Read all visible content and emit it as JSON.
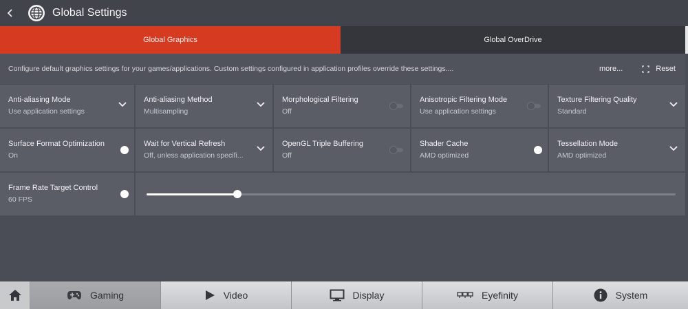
{
  "header": {
    "title": "Global Settings"
  },
  "tabs": [
    {
      "label": "Global Graphics",
      "active": true
    },
    {
      "label": "Global OverDrive",
      "active": false
    }
  ],
  "info": {
    "text": "Configure default graphics settings for your games/applications. Custom settings configured in application profiles override these settings....",
    "more_label": "more...",
    "reset_label": "Reset"
  },
  "settings": {
    "row1": [
      {
        "label": "Anti-aliasing Mode",
        "value": "Use application settings",
        "control": "dropdown"
      },
      {
        "label": "Anti-aliasing Method",
        "value": "Multisampling",
        "control": "dropdown"
      },
      {
        "label": "Morphological Filtering",
        "value": "Off",
        "control": "toggle",
        "on": false
      },
      {
        "label": "Anisotropic Filtering Mode",
        "value": "Use application settings",
        "control": "toggle",
        "on": false
      },
      {
        "label": "Texture Filtering Quality",
        "value": "Standard",
        "control": "dropdown"
      }
    ],
    "row2": [
      {
        "label": "Surface Format Optimization",
        "value": "On",
        "control": "toggle",
        "on": true
      },
      {
        "label": "Wait for Vertical Refresh",
        "value": "Off, unless application specifi...",
        "control": "dropdown"
      },
      {
        "label": "OpenGL Triple Buffering",
        "value": "Off",
        "control": "toggle",
        "on": false
      },
      {
        "label": "Shader Cache",
        "value": "AMD optimized",
        "control": "toggle",
        "on": true
      },
      {
        "label": "Tessellation Mode",
        "value": "AMD optimized",
        "control": "dropdown"
      }
    ],
    "frtc": {
      "label": "Frame Rate Target Control",
      "value": "60 FPS",
      "on": true,
      "slider_fraction": 0.172
    }
  },
  "bottom_nav": [
    {
      "label": "Gaming",
      "icon": "gamepad-icon",
      "active": true
    },
    {
      "label": "Video",
      "icon": "play-icon",
      "active": false
    },
    {
      "label": "Display",
      "icon": "monitor-icon",
      "active": false
    },
    {
      "label": "Eyefinity",
      "icon": "eyefinity-icon",
      "active": false
    },
    {
      "label": "System",
      "icon": "info-icon",
      "active": false
    }
  ],
  "colors": {
    "accent": "#d63b22",
    "panel": "#5a5d65",
    "background": "#4a4d55"
  }
}
